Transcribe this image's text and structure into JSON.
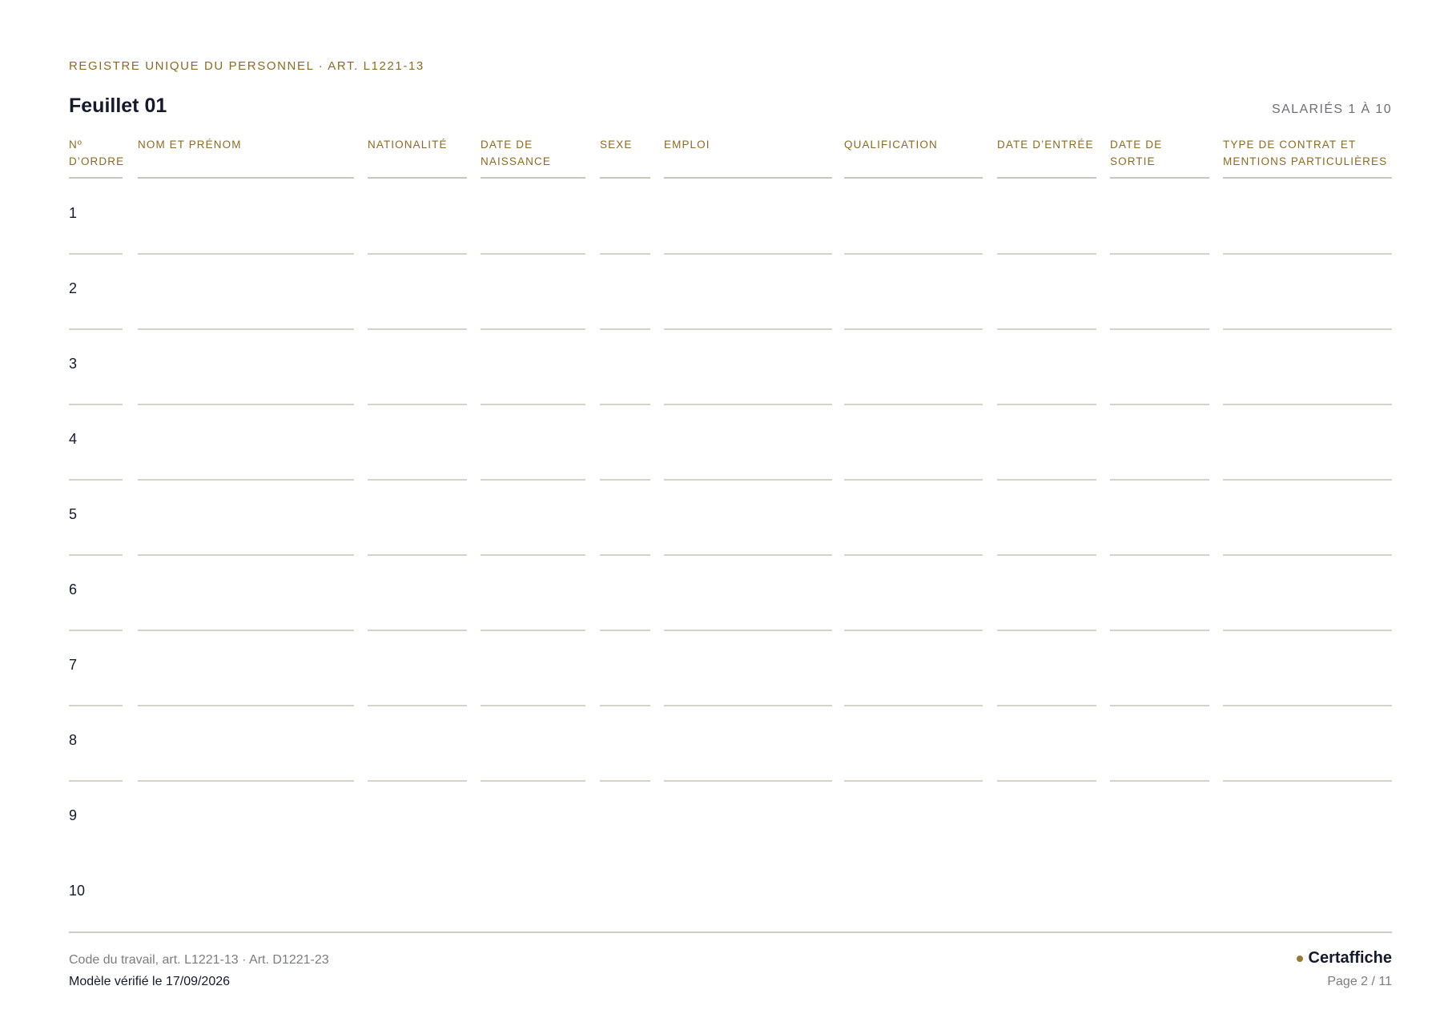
{
  "header": {
    "eyebrow": "REGISTRE UNIQUE DU PERSONNEL · ART. L1221-13",
    "title": "Feuillet 01",
    "range": "SALARIÉS 1 À 10"
  },
  "table": {
    "columns": [
      "Nº\nD’ORDRE",
      "NOM ET PRÉNOM",
      "NATIONALITÉ",
      "DATE DE\nNAISSANCE",
      "SEXE",
      "EMPLOI",
      "QUALIFICATION",
      "DATE D’ENTRÉE",
      "DATE DE SORTIE",
      "TYPE DE CONTRAT ET\nMENTIONS PARTICULIÈRES"
    ],
    "rows": [
      "1",
      "2",
      "3",
      "4",
      "5",
      "6",
      "7",
      "8",
      "9",
      "10"
    ]
  },
  "footer": {
    "reference": "Code du travail, art. L1221-13 · Art. D1221-23",
    "verified": "Modèle vérifié le 17/09/2026",
    "brand": "Certaffiche",
    "page": "Page 2 / 11"
  },
  "colors": {
    "accent": "#8b6a25",
    "text": "#141a2c",
    "muted": "#7a7c82",
    "rule": "#d5d2c8"
  }
}
